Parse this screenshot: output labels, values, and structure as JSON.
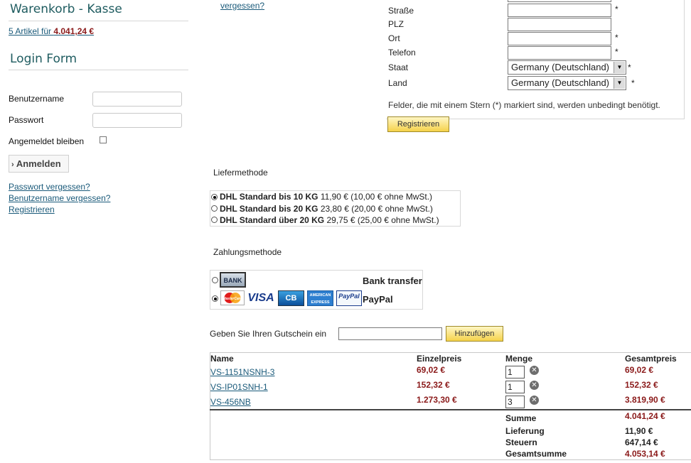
{
  "sidebar": {
    "cart_heading": "Warenkorb - Kasse",
    "cart_summary_prefix": "5 Artikel für ",
    "cart_summary_total": "4.041,24 €",
    "login_heading": "Login Form",
    "username_label": "Benutzername",
    "password_label": "Passwort",
    "remember_label": "Angemeldet bleiben",
    "login_button": "Anmelden",
    "links": [
      "Passwort vergessen?",
      "Benutzername vergessen?",
      "Registrieren"
    ]
  },
  "top_link": "vergessen?",
  "register_form": {
    "fields": [
      {
        "label": "Straße",
        "required": "*"
      },
      {
        "label": "PLZ",
        "required": ""
      },
      {
        "label": "Ort",
        "required": "*"
      },
      {
        "label": "Telefon",
        "required": "*"
      }
    ],
    "state_label": "Staat",
    "state_value": "Germany (Deutschland)",
    "country_label": "Land",
    "country_value": "Germany (Deutschland)",
    "required_mark": "*",
    "note": "Felder, die mit einem Stern (*) markiert sind, werden unbedingt benötigt.",
    "submit_label": "Registrieren"
  },
  "delivery": {
    "heading": "Liefermethode",
    "options": [
      {
        "name": "DHL Standard bis 10 KG",
        "price": "11,90 € (10,00 € ohne MwSt.)",
        "selected": true
      },
      {
        "name": "DHL Standard bis 20 KG",
        "price": "23,80 € (20,00 € ohne MwSt.)",
        "selected": false
      },
      {
        "name": "DHL Standard über 20 KG",
        "price": "29,75 € (25,00 € ohne MwSt.)",
        "selected": false
      }
    ]
  },
  "payment": {
    "heading": "Zahlungsmethode",
    "bank_logo": "BANK",
    "bank_label": "Bank transfer",
    "cards": [
      "MasterCard",
      "VISA",
      "CB",
      "AMERICAN EXPRESS",
      "PayPal"
    ],
    "paypal_label": "PayPal"
  },
  "coupon": {
    "label": "Geben Sie Ihren Gutschein ein",
    "button": "Hinzufügen"
  },
  "cart_table": {
    "headers": [
      "Name",
      "Einzelpreis",
      "Menge",
      "Gesamtpreis"
    ],
    "rows": [
      {
        "name": "VS-1151NSNH-3",
        "unit": "69,02 €",
        "qty": "1",
        "total": "69,02 €"
      },
      {
        "name": "VS-IP01SNH-1",
        "unit": "152,32 €",
        "qty": "1",
        "total": "152,32 €"
      },
      {
        "name": "VS-456NB",
        "unit": "1.273,30 €",
        "qty": "3",
        "total": "3.819,90 €"
      }
    ],
    "summary": [
      {
        "label": "Summe",
        "value": "4.041,24 €"
      },
      {
        "label": "Lieferung",
        "value": "11,90 €"
      },
      {
        "label": "Steuern",
        "value": "647,14 €"
      },
      {
        "label": "Gesamtsumme",
        "value": "4.053,14 €"
      }
    ]
  },
  "colors": {
    "heading": "#1f5c60",
    "link": "#1a5a7a",
    "price": "#8b1a1a",
    "button_yellow": "#f5d24a"
  }
}
